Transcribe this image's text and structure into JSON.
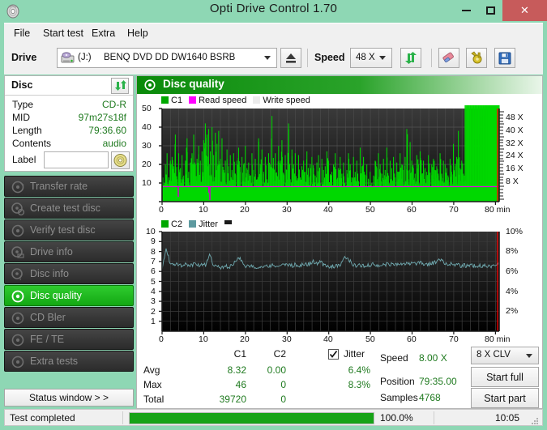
{
  "window": {
    "title": "Opti Drive Control 1.70",
    "icon": "disc-icon",
    "minimize": "minimize-icon",
    "maximize": "maximize-icon",
    "close": "✕"
  },
  "menu": {
    "items": [
      {
        "label": "File"
      },
      {
        "label": "Start test"
      },
      {
        "label": "Extra"
      },
      {
        "label": "Help"
      }
    ]
  },
  "toolbar": {
    "drive_label": "Drive",
    "drive_letter": "(J:)",
    "drive_name": "BENQ DVD DD DW1640 BSRB",
    "eject_icon": "eject-icon",
    "speed_label": "Speed",
    "speed_value": "48 X",
    "refresh_icon": "refresh-icon",
    "eraser_icon": "eraser-icon",
    "tools_icon": "tools-icon",
    "save_icon": "save-icon"
  },
  "disc_panel": {
    "header": "Disc",
    "refresh_icon": "refresh-icon",
    "rows": [
      {
        "key": "Type",
        "value": "CD-R"
      },
      {
        "key": "MID",
        "value": "97m27s18f"
      },
      {
        "key": "Length",
        "value": "79:36.60"
      },
      {
        "key": "Contents",
        "value": "audio"
      }
    ],
    "label_key": "Label",
    "label_value": "",
    "label_placeholder": "",
    "label_button_icon": "cd-icon"
  },
  "sidebar": {
    "items": [
      {
        "label": "Transfer rate",
        "icon": "disc-transfer-icon",
        "active": false
      },
      {
        "label": "Create test disc",
        "icon": "disc-create-icon",
        "active": false
      },
      {
        "label": "Verify test disc",
        "icon": "disc-verify-icon",
        "active": false
      },
      {
        "label": "Drive info",
        "icon": "disc-drive-icon",
        "active": false
      },
      {
        "label": "Disc info",
        "icon": "disc-info-icon",
        "active": false
      },
      {
        "label": "Disc quality",
        "icon": "disc-quality-icon",
        "active": true
      },
      {
        "label": "CD Bler",
        "icon": "disc-bler-icon",
        "active": false
      },
      {
        "label": "FE / TE",
        "icon": "disc-fete-icon",
        "active": false
      },
      {
        "label": "Extra tests",
        "icon": "disc-extra-icon",
        "active": false
      }
    ],
    "status_window_button": "Status window > >"
  },
  "main": {
    "title": "Disc quality",
    "icon": "disc-quality-icon"
  },
  "stats": {
    "col_c1": "C1",
    "col_c2": "C2",
    "jitter_label": "Jitter",
    "jitter_checked": true,
    "rows": [
      {
        "name": "Avg",
        "c1": "8.32",
        "c2": "0.00",
        "jitter": "6.4%"
      },
      {
        "name": "Max",
        "c1": "46",
        "c2": "0",
        "jitter": "8.3%"
      },
      {
        "name": "Total",
        "c1": "39720",
        "c2": "0",
        "jitter": ""
      }
    ],
    "speed_key": "Speed",
    "speed_value": "8.00 X",
    "position_key": "Position",
    "position_value": "79:35.00",
    "samples_key": "Samples",
    "samples_value": "4768",
    "write_mode": "8 X CLV",
    "start_full": "Start full",
    "start_part": "Start part"
  },
  "statusbar": {
    "message": "Test completed",
    "percent_text": "100.0%",
    "percent_value": 100,
    "elapsed": "10:05"
  },
  "colors": {
    "title_bar": "#8ed7b4",
    "close_button": "#c75b5b",
    "accent_green": "#13a813",
    "value_green": "#1f7a1f",
    "c1_green": "#00d800",
    "read_speed_magenta": "#e600e6",
    "write_speed_gray": "#e8e8e8",
    "jitter_teal": "#5e9aa0",
    "plot_background": "#1c1c1c",
    "cursor_red": "#ff0000"
  },
  "chart_data": [
    {
      "type": "area",
      "title": "C1 / Read speed / Write speed",
      "xlabel": "min",
      "ylabel": "C1",
      "xlim": [
        0,
        81
      ],
      "ylim": [
        0,
        50
      ],
      "y2lim": [
        0,
        50
      ],
      "xticks": [
        0,
        10,
        20,
        30,
        40,
        50,
        60,
        70,
        80
      ],
      "xticklabels": [
        "0",
        "10",
        "20",
        "30",
        "40",
        "50",
        "60",
        "70",
        "80 min"
      ],
      "yticks": [
        10,
        20,
        30,
        40,
        50
      ],
      "yticklabels": [
        "10",
        "20",
        "30",
        "40",
        "50"
      ],
      "y2ticks": [
        8,
        16,
        24,
        32,
        40,
        48
      ],
      "y2ticklabels": [
        "8 X",
        "16 X",
        "24 X",
        "32 X",
        "40 X",
        "48 X"
      ],
      "grid": true,
      "legend": [
        {
          "name": "C1",
          "color": "#00b000"
        },
        {
          "name": "Read speed",
          "color": "#ff00ff"
        },
        {
          "name": "Write speed",
          "color": "#e8e8e8"
        }
      ],
      "series": [
        {
          "name": "C1",
          "color": "#00d800",
          "type": "spike-area",
          "x": [
            0,
            0.4,
            0.8,
            1.2,
            1.6,
            2,
            2.4,
            2.8,
            3.2,
            3.6,
            4,
            4.4,
            4.8,
            5.2,
            5.6,
            6,
            6.4,
            6.8,
            7.2,
            7.6,
            8,
            8.4,
            8.8,
            9.2,
            9.6,
            10,
            10.4,
            10.8,
            11.2,
            11.6,
            12,
            12.4,
            12.8,
            13.2,
            13.6,
            14,
            14.4,
            14.8,
            15.2,
            15.6,
            16,
            16.4,
            16.8,
            17.2,
            17.6,
            18,
            18.4,
            18.8,
            19.2,
            19.6,
            20,
            20.4,
            20.8,
            21.2,
            21.6,
            22,
            22.4,
            22.8,
            23.2,
            23.6,
            24,
            24.4,
            24.8,
            25.2,
            25.6,
            26,
            26.4,
            26.8,
            27.2,
            27.6,
            28,
            28.4,
            28.8,
            29.2,
            29.6,
            30,
            30.4,
            30.8,
            31.2,
            31.6,
            32,
            32.4,
            32.8,
            33.2,
            33.6,
            34,
            34.4,
            34.8,
            35.2,
            35.6,
            36,
            36.4,
            36.8,
            37.2,
            37.6,
            38,
            38.4,
            38.8,
            39.2,
            39.6,
            40,
            40.4,
            40.8,
            41.2,
            41.6,
            42,
            42.4,
            42.8,
            43.2,
            43.6,
            44,
            44.4,
            44.8,
            45.2,
            45.6,
            46,
            46.4,
            46.8,
            47.2,
            47.6,
            48,
            48.4,
            48.8,
            49.2,
            49.6,
            50,
            50.4,
            50.8,
            51.2,
            51.6,
            52,
            52.4,
            52.8,
            53.2,
            53.6,
            54,
            54.4,
            54.8,
            55.2,
            55.6,
            56,
            56.4,
            56.8,
            57.2,
            57.6,
            58,
            58.4,
            58.8,
            59.2,
            59.6,
            60,
            60.4,
            60.8,
            61.2,
            61.6,
            62,
            62.4,
            62.8,
            63.2,
            63.6,
            64,
            64.4,
            64.8,
            65.2,
            65.6,
            66,
            66.4,
            66.8,
            67.2,
            67.6,
            68,
            68.4,
            68.8,
            69.2,
            69.6,
            70,
            70.4,
            70.8,
            71.2,
            71.6,
            72,
            72.4,
            72.8,
            73.2,
            73.6,
            74,
            74.4,
            74.8,
            75.2,
            75.6,
            76,
            76.4,
            76.8,
            77.2,
            77.6,
            78,
            78.4,
            78.8,
            79.2,
            79.6,
            80,
            80.4,
            80.8
          ],
          "values": [
            18,
            9,
            20,
            26,
            13,
            22,
            24,
            19,
            36,
            12,
            26,
            18,
            25,
            14,
            22,
            34,
            16,
            21,
            26,
            36,
            20,
            23,
            30,
            22,
            27,
            33,
            42,
            36,
            39,
            27,
            40,
            25,
            37,
            31,
            38,
            23,
            34,
            17,
            22,
            28,
            19,
            25,
            17,
            26,
            15,
            22,
            29,
            16,
            24,
            20,
            30,
            18,
            21,
            14,
            26,
            17,
            23,
            12,
            34,
            20,
            28,
            16,
            24,
            12,
            26,
            20,
            46,
            18,
            26,
            14,
            30,
            22,
            33,
            15,
            25,
            17,
            42,
            12,
            28,
            20,
            26,
            11,
            25,
            13,
            19,
            22,
            16,
            27,
            13,
            20,
            24,
            18,
            14,
            21,
            25,
            10,
            23,
            17,
            19,
            27,
            22,
            14,
            16,
            20,
            26,
            12,
            18,
            24,
            15,
            21,
            9,
            17,
            26,
            20,
            13,
            24,
            16,
            22,
            11,
            29,
            19,
            24,
            14,
            20,
            8,
            16,
            10,
            14,
            22,
            18,
            26,
            20,
            15,
            23,
            17,
            29,
            14,
            22,
            18,
            24,
            13,
            21,
            16,
            26,
            20,
            17,
            24,
            39,
            12,
            32,
            22,
            18,
            15,
            25,
            20,
            27,
            14,
            22,
            18,
            16,
            25,
            12,
            20,
            23,
            17,
            19,
            14,
            26,
            15,
            22,
            20,
            18,
            13,
            23,
            16,
            31,
            19,
            24,
            38,
            18,
            22,
            15
          ]
        },
        {
          "name": "Read speed",
          "color": "#e600e6",
          "type": "line",
          "constant_x": 8.0,
          "note": "flat magenta line at ~8X with two downward spikes near 4 min and 11.5 min"
        },
        {
          "name": "Write speed",
          "color": "#e8e8e8",
          "type": "none",
          "values": []
        }
      ],
      "cursor": {
        "x": 80.5,
        "color": "#ff0000"
      }
    },
    {
      "type": "line",
      "title": "C2 / Jitter",
      "xlabel": "min",
      "ylabel": "C2",
      "xlim": [
        0,
        81
      ],
      "ylim": [
        0,
        10
      ],
      "y2lim": [
        0,
        10
      ],
      "xticks": [
        0,
        10,
        20,
        30,
        40,
        50,
        60,
        70,
        80
      ],
      "xticklabels": [
        "0",
        "10",
        "20",
        "30",
        "40",
        "50",
        "60",
        "70",
        "80 min"
      ],
      "yticks": [
        1,
        2,
        3,
        4,
        5,
        6,
        7,
        8,
        9,
        10
      ],
      "yticklabels": [
        "1",
        "2",
        "3",
        "4",
        "5",
        "6",
        "7",
        "8",
        "9",
        "10"
      ],
      "y2ticks": [
        2,
        4,
        6,
        8,
        10
      ],
      "y2ticklabels": [
        "2%",
        "4%",
        "6%",
        "8%",
        "10%"
      ],
      "grid": true,
      "legend": [
        {
          "name": "C2",
          "color": "#00b000"
        },
        {
          "name": "Jitter",
          "color": "#5e9aa0"
        }
      ],
      "series": [
        {
          "name": "C2",
          "color": "#00b000",
          "type": "line",
          "values": []
        },
        {
          "name": "Jitter",
          "color": "#6fa8ae",
          "type": "line",
          "x": [
            0,
            1,
            2,
            3,
            4,
            5,
            6,
            7,
            8,
            9,
            10,
            11,
            11.5,
            12,
            13,
            14,
            15,
            16,
            17,
            18,
            18.5,
            19,
            20,
            21,
            22,
            23,
            24,
            25,
            26,
            27,
            28,
            29,
            30,
            31,
            32,
            33,
            34,
            35,
            36,
            37,
            38,
            39,
            40,
            41,
            42,
            43,
            44,
            44.3,
            45,
            46,
            47,
            48,
            49,
            50,
            51,
            52,
            53,
            54,
            55,
            56,
            57,
            58,
            59,
            60,
            61,
            62,
            63,
            64,
            65,
            66,
            67,
            67.5,
            68,
            69,
            70,
            71,
            72,
            73,
            74,
            75,
            76,
            77,
            78,
            79,
            80,
            80.6
          ],
          "values": [
            6.3,
            8.4,
            6.9,
            6.6,
            6.7,
            6.6,
            6.8,
            6.6,
            6.7,
            6.6,
            6.8,
            6.6,
            7.8,
            6.5,
            6.4,
            6.4,
            6.5,
            6.5,
            6.7,
            7.4,
            7.1,
            6.6,
            6.5,
            6.5,
            6.4,
            6.5,
            6.5,
            6.5,
            6.6,
            6.6,
            6.7,
            6.6,
            6.7,
            6.6,
            6.7,
            6.6,
            6.8,
            6.7,
            7.0,
            6.8,
            6.9,
            6.6,
            6.5,
            6.5,
            6.5,
            6.6,
            7.4,
            7.2,
            6.7,
            6.6,
            6.6,
            6.6,
            6.6,
            6.7,
            6.6,
            6.7,
            6.6,
            6.8,
            6.7,
            6.8,
            6.7,
            6.8,
            6.7,
            6.8,
            6.7,
            6.9,
            6.8,
            6.7,
            6.8,
            6.9,
            7.2,
            6.9,
            6.8,
            6.7,
            6.7,
            6.6,
            6.6,
            6.6,
            6.6,
            6.6,
            6.6,
            6.6,
            6.5,
            6.5,
            6.5,
            6.9
          ]
        }
      ],
      "cursor": {
        "x": 80.5,
        "color": "#ff0000"
      }
    }
  ]
}
